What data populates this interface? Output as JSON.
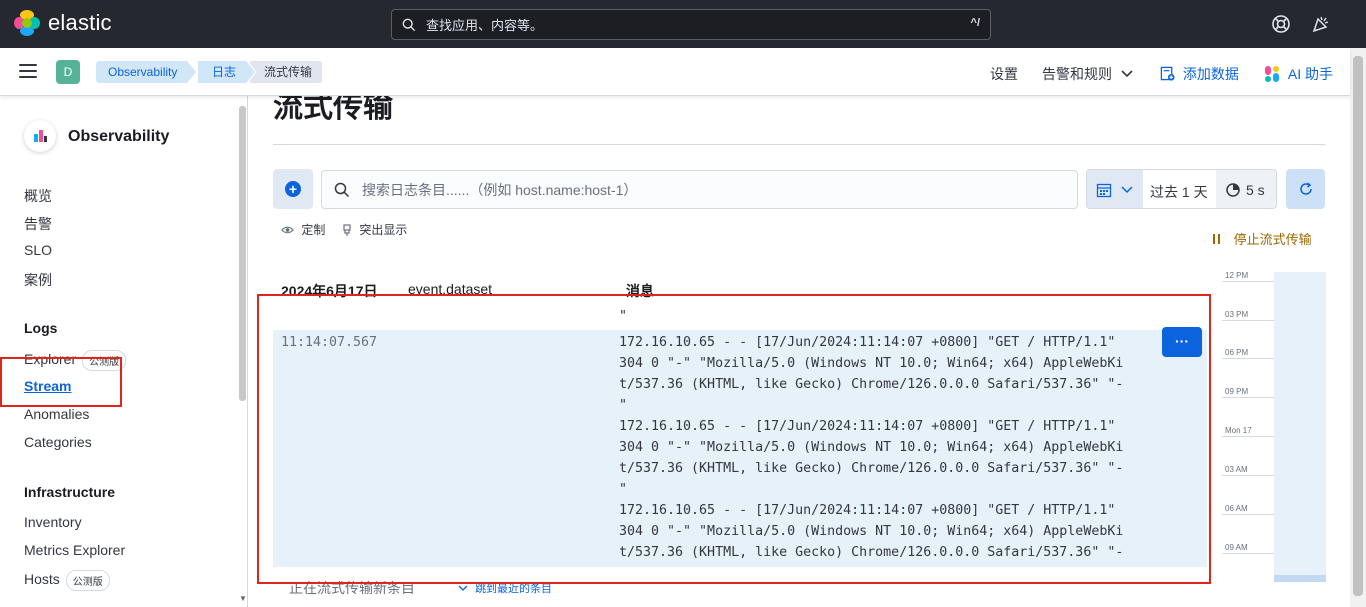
{
  "header": {
    "brand": "elastic",
    "search_placeholder": "查找应用、内容等。",
    "search_shortcut": "^/"
  },
  "breadcrumbs": {
    "space_initial": "D",
    "items": [
      "Observability",
      "日志",
      "流式传输"
    ],
    "links": {
      "settings": "设置",
      "alerts": "告警和规则",
      "add_data": "添加数据",
      "ai": "AI 助手"
    }
  },
  "sidenav": {
    "title": "Observability",
    "top_items": [
      "概览",
      "告警",
      "SLO",
      "案例"
    ],
    "logs_section": "Logs",
    "logs_items": [
      "Explorer",
      "Stream",
      "Anomalies",
      "Categories"
    ],
    "beta_label": "公测版",
    "infra_section": "Infrastructure",
    "infra_items": [
      "Inventory",
      "Metrics Explorer",
      "Hosts"
    ]
  },
  "page": {
    "title": "流式传输",
    "query_placeholder": "搜索日志条目......（例如 host.name:host-1）",
    "time_range": "过去 1 天",
    "refresh_interval": "5 s",
    "customize": "定制",
    "highlight": "突出显示",
    "stop_streaming": "停止流式传输",
    "columns": [
      "2024年6月17日",
      "event.dataset",
      "消息"
    ],
    "leading_quote": "\"",
    "row_timestamp": "11:14:07.567",
    "messages": [
      "172.16.10.65 - - [17/Jun/2024:11:14:07 +0800] \"GET / HTTP/1.1\"\n304 0 \"-\" \"Mozilla/5.0 (Windows NT 10.0; Win64; x64) AppleWebKi\nt/537.36 (KHTML, like Gecko) Chrome/126.0.0.0 Safari/537.36\" \"-\n\"",
      "172.16.10.65 - - [17/Jun/2024:11:14:07 +0800] \"GET / HTTP/1.1\"\n304 0 \"-\" \"Mozilla/5.0 (Windows NT 10.0; Win64; x64) AppleWebKi\nt/537.36 (KHTML, like Gecko) Chrome/126.0.0.0 Safari/537.36\" \"-\n\"",
      "172.16.10.65 - - [17/Jun/2024:11:14:07 +0800] \"GET / HTTP/1.1\"\n304 0 \"-\" \"Mozilla/5.0 (Windows NT 10.0; Win64; x64) AppleWebKi\nt/537.36 (KHTML, like Gecko) Chrome/126.0.0.0 Safari/537.36\" \"-"
    ],
    "row_actions": "···",
    "streaming_status": "正在流式传输新条目",
    "jump_to_latest": "跳到最近的条目",
    "minimap_ticks": [
      "12 PM",
      "03 PM",
      "06 PM",
      "09 PM",
      "Mon 17",
      "03 AM",
      "06 AM",
      "09 AM"
    ]
  },
  "colors": {
    "header_bg": "#25282f",
    "accent": "#0b64dd",
    "highlight_row": "#e6f1fa",
    "annotation": "#e0251b"
  }
}
